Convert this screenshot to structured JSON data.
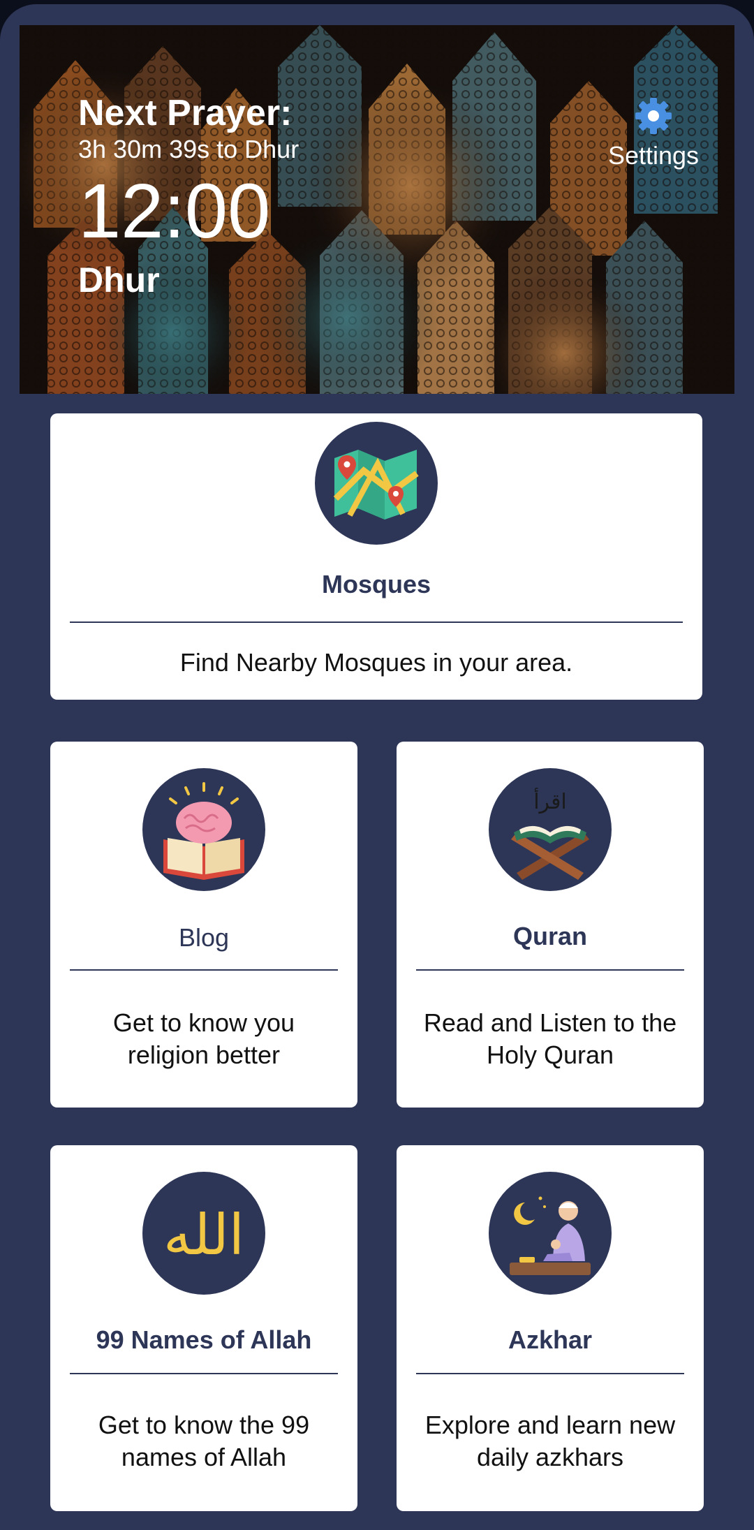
{
  "header": {
    "next_prayer_label": "Next Prayer:",
    "countdown": "3h 30m 39s to Dhur",
    "time": "12:00",
    "prayer_name": "Dhur",
    "settings_label": "Settings"
  },
  "cards": {
    "mosques": {
      "title": "Mosques",
      "description": "Find Nearby Mosques in your area.",
      "icon": "map-icon"
    },
    "blog": {
      "title": "Blog",
      "description_line1": "Get to know you",
      "description_line2": "religion better",
      "icon": "brain-book-icon"
    },
    "quran": {
      "title": "Quran",
      "description_line1": "Read and Listen to the",
      "description_line2": "Holy Quran",
      "icon": "quran-stand-icon",
      "icon_text": "اقرأ"
    },
    "names": {
      "title": "99 Names of Allah",
      "description_line1": "Get to know the 99",
      "description_line2": "names of Allah",
      "icon": "allah-calligraphy-icon",
      "icon_text": "الله"
    },
    "azkhar": {
      "title": "Azkhar",
      "description_line1": "Explore and learn new",
      "description_line2": "daily azkhars",
      "icon": "praying-man-icon"
    }
  },
  "colors": {
    "primary": "#2d3657",
    "card": "#ffffff",
    "gear": "#4a90e2"
  }
}
